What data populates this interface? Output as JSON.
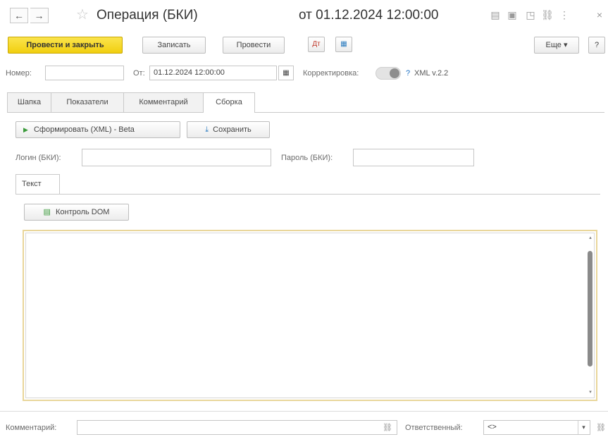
{
  "window": {
    "title": "Операция (БКИ)",
    "date_title": "от 01.12.2024 12:00:00",
    "back_icon": "←",
    "forward_icon": "→",
    "star_icon": "☆",
    "icons": [
      "▤",
      "▣",
      "◳",
      "⛓",
      "⋮",
      "×"
    ]
  },
  "toolbar": {
    "post_close": "Провести и закрыть",
    "save": "Записать",
    "post": "Провести",
    "icon1": "Дт",
    "icon2": "▦",
    "more": "Еще",
    "more_arrow": "▾",
    "help": "?"
  },
  "header": {
    "number_label": "Номер:",
    "number_value": "",
    "from_label": "От:",
    "from_value": "01.12.2024 12:00:00",
    "calendar_icon": "▦",
    "correction_label": "Корректировка:",
    "help_mark": "?",
    "xml_version": "XML v.2.2"
  },
  "tabs": [
    {
      "label": "Шапка",
      "active": false
    },
    {
      "label": "Показатели",
      "active": false
    },
    {
      "label": "Комментарий",
      "active": false
    },
    {
      "label": "Сборка",
      "active": true
    }
  ],
  "assembly": {
    "form_button": "Сформировать (XML) - Beta",
    "play_icon": "▶",
    "save_button": "Сохранить",
    "download_icon": "⤓",
    "login_label": "Логин (БКИ):",
    "login_value": "",
    "password_label": "Пароль (БКИ):",
    "password_value": "",
    "inner_tab": "Текст",
    "dom_button": "Контроль DOM",
    "dom_icon": "▤",
    "text_value": "",
    "scroll_up": "▴",
    "scroll_down": "▾"
  },
  "footer": {
    "comment_label": "Комментарий:",
    "comment_value": "",
    "link_icon": "⛓",
    "responsible_label": "Ответственный:",
    "responsible_value": "<>",
    "dropdown_icon": "▾"
  }
}
